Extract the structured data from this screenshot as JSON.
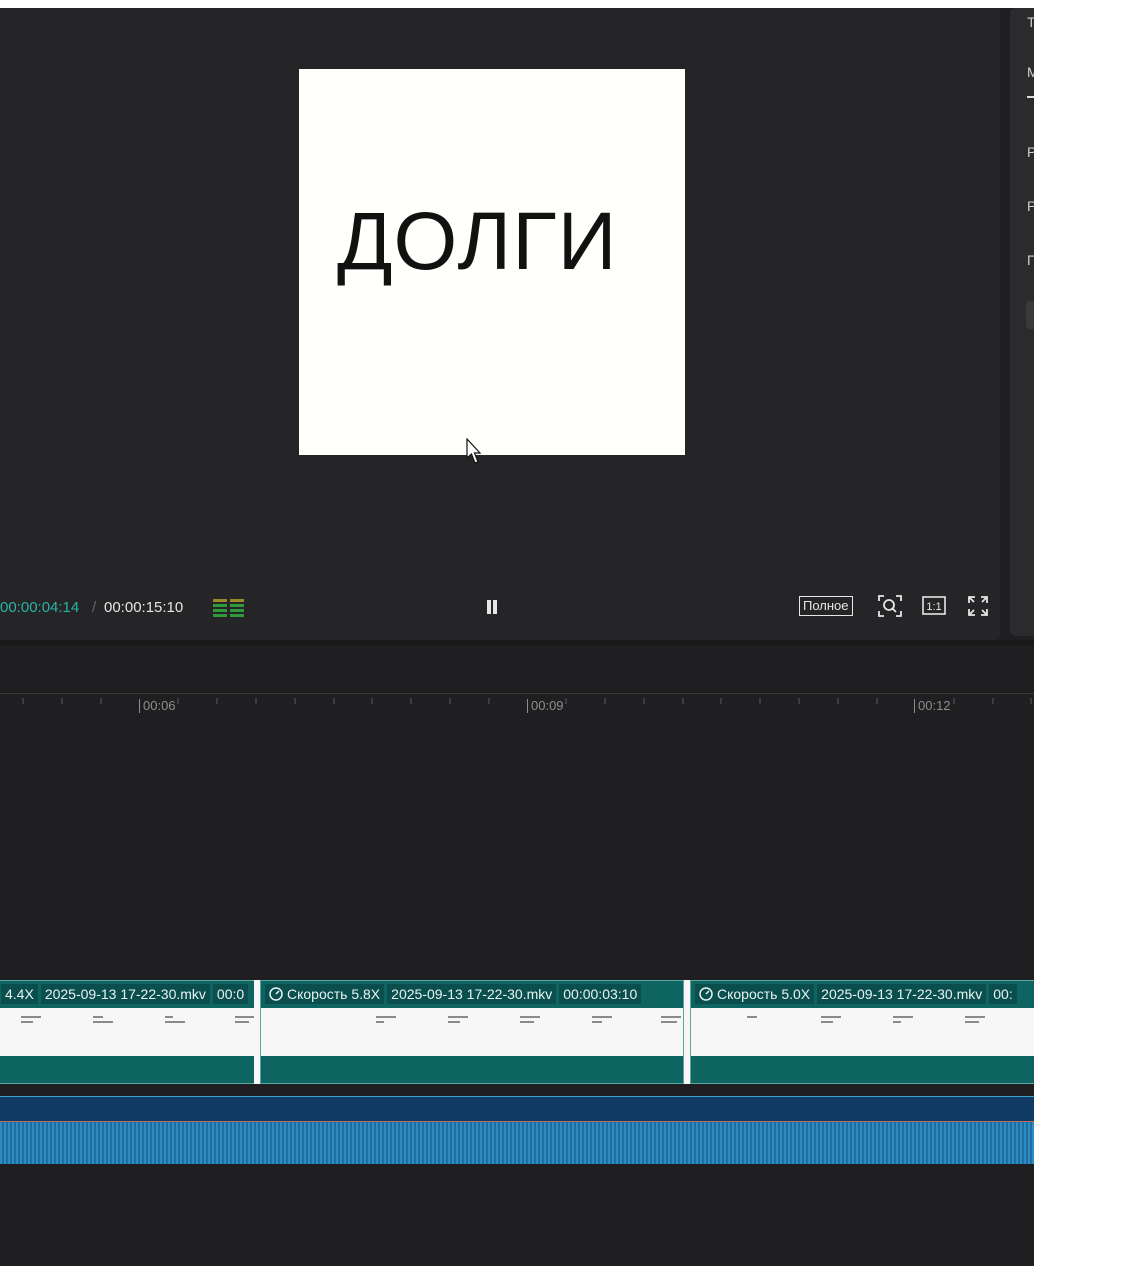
{
  "preview": {
    "canvas_text": "ДОЛГИ",
    "timecode_current": "00:00:04:14",
    "timecode_separator": "/",
    "timecode_total": "00:00:15:10",
    "quality_label": "Полное",
    "icons": [
      "audio-meter-icon",
      "pause-icon",
      "zoom-icon",
      "actual-size-icon",
      "fullscreen-icon"
    ]
  },
  "right_panel": {
    "letters": [
      "Т",
      "М",
      "Р",
      "Р",
      "П"
    ]
  },
  "ruler": {
    "ticks": [
      "00:06",
      "00:09",
      "00:12"
    ]
  },
  "timeline": {
    "clips": [
      {
        "speed": "4.4X",
        "file": "2025-09-13 17-22-30.mkv",
        "duration": "00:0"
      },
      {
        "speed": "Скорость 5.8X",
        "file": "2025-09-13 17-22-30.mkv",
        "duration": "00:00:03:10"
      },
      {
        "speed": "Скорость 5.0X",
        "file": "2025-09-13 17-22-30.mkv",
        "duration": "00:"
      }
    ]
  },
  "colors": {
    "accent_timecode": "#2ab3a5",
    "clip_teal": "#0e6461",
    "audio_blue": "#2e8cc0"
  }
}
